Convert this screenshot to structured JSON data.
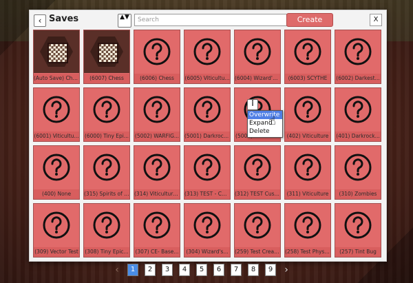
{
  "header": {
    "back_icon": "‹",
    "title": "Saves",
    "sort_icon": "▲▼",
    "search_placeholder": "Search",
    "create_label": "Create",
    "close_label": "X"
  },
  "menu": {
    "kebab_icon": "⋮",
    "items": [
      "Overwrite",
      "Expand",
      "Delete"
    ]
  },
  "grid": {
    "rows": [
      [
        "(Auto Save) Chess",
        "(6007) Chess",
        "(6006) Chess",
        "(6005) Viticultu...",
        "(6004) Wizard's...",
        "(6003) SCYTHE",
        "(6002) Darkest..."
      ],
      [
        "(6001) Viticultu...",
        "(6000) Tiny Epi...",
        "(5002) WARFIG...",
        "(5001) Darkrock...",
        "(5000) Darkroc...",
        "(402) Viticulture",
        "(401) Darkrock..."
      ],
      [
        "(400) None",
        "(315) Spirits of t...",
        "(314) Viticulture...",
        "(313) TEST - Cus...",
        "(312) TEST  Cust...",
        "(311) Viticulture",
        "(310) Zombies"
      ],
      [
        "(309) Vector Test",
        "(308) Tiny Epic...",
        "(307) CE- Base...",
        "(304) Wizard's...",
        "(259) Test Creat...",
        "(258) Test Physi...",
        "(257) Tint Bug"
      ]
    ],
    "chess_thumbs": [
      "(Auto Save) Chess",
      "(6007) Chess"
    ]
  },
  "pagination": {
    "prev_icon": "‹",
    "next_icon": "›",
    "pages": [
      "1",
      "2",
      "3",
      "4",
      "5",
      "6",
      "7",
      "8",
      "9"
    ],
    "active_page": "1"
  },
  "colors": {
    "card": "#e16a6a",
    "create": "#de6b6b",
    "active_page": "#4a8de6",
    "menu_selected": "#4f7fe5"
  }
}
